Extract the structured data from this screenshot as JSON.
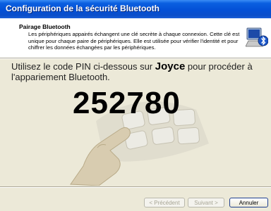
{
  "window": {
    "title": "Configuration de la sécurité Bluetooth"
  },
  "header": {
    "title": "Pairage Bluetooth",
    "description": "Les périphériques appairés échangent une clé secrète à chaque connexion. Cette clé est unique pour chaque paire de périphériques. Elle est utilisée pour vérifier l'identité et pour chiffrer les données échangées par les périphériques.",
    "icon": "bluetooth-computer-icon"
  },
  "content": {
    "instruction_before": "Utilisez le code PIN ci-dessous sur ",
    "device_name": "Joyce",
    "instruction_after": " pour procéder à l'appariement Bluetooth.",
    "pin": "252780",
    "illustration": "keypad-hand-illustration"
  },
  "buttons": {
    "previous": "< Précédent",
    "next": "Suivant >",
    "cancel": "Annuler"
  },
  "colors": {
    "titlebar": "#0450d6",
    "background": "#ece9d8"
  }
}
